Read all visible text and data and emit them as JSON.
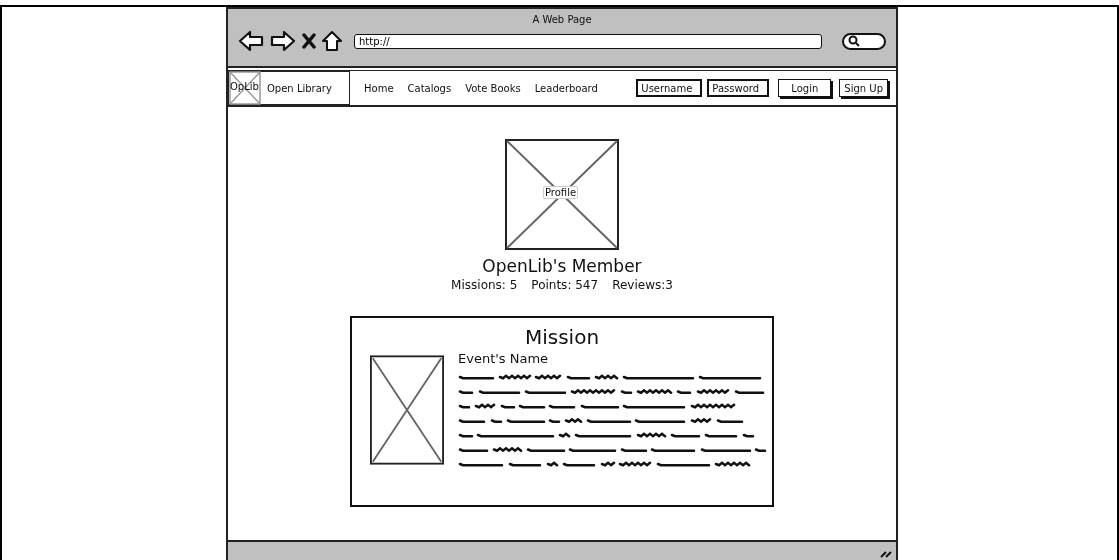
{
  "browser": {
    "title": "A Web Page",
    "url": "http://"
  },
  "navbar": {
    "logo": "OpLib",
    "site_name": "Open Library",
    "links": [
      "Home",
      "Catalogs",
      "Vote Books",
      "Leaderboard"
    ],
    "username": {
      "value": "Username"
    },
    "password": {
      "value": "Password"
    },
    "buttons": [
      "Login",
      "Sign Up"
    ]
  },
  "profile": {
    "image_label": "Profile",
    "name": "OpenLib's Member",
    "stats": [
      "Missions: 5",
      "Points: 547",
      "Reviews:3"
    ]
  },
  "mission": {
    "title": "Mission",
    "event_name": "Event's Name"
  }
}
